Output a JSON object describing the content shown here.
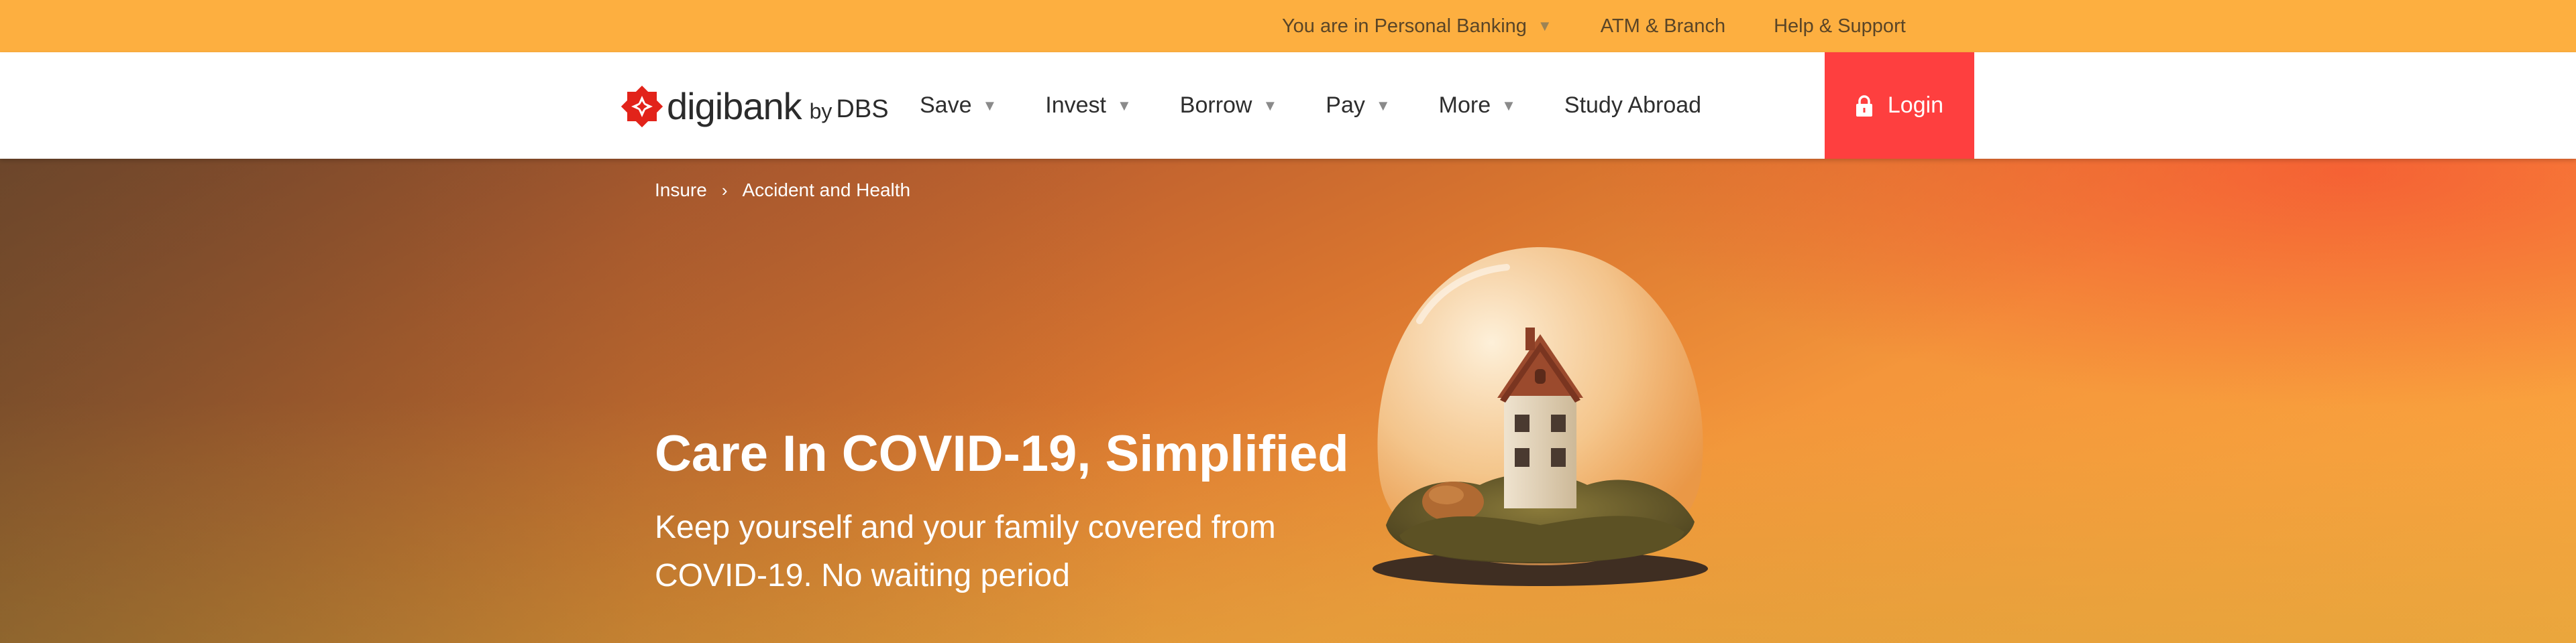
{
  "topbar": {
    "segment_label": "You are in Personal Banking",
    "segment_caret_icon": "caret-down-icon",
    "atm_label": "ATM & Branch",
    "help_label": "Help & Support"
  },
  "brand": {
    "wordmark": "digibank",
    "by": "by",
    "bank": "DBS",
    "colors": {
      "primary_red": "#fe3f3f",
      "topbar_orange": "#fdaf40"
    }
  },
  "nav": {
    "items": [
      {
        "label": "Save",
        "has_dropdown": true
      },
      {
        "label": "Invest",
        "has_dropdown": true
      },
      {
        "label": "Borrow",
        "has_dropdown": true
      },
      {
        "label": "Pay",
        "has_dropdown": true
      },
      {
        "label": "More",
        "has_dropdown": true
      },
      {
        "label": "Study Abroad",
        "has_dropdown": false
      }
    ],
    "caret_icon": "caret-down-icon",
    "login_label": "Login",
    "login_icon": "lock-icon"
  },
  "breadcrumb": {
    "items": [
      "Insure",
      "Accident and Health"
    ],
    "separator_icon": "chevron-right-icon"
  },
  "hero": {
    "title": "Care In COVID-19, Simplified",
    "subtitle": "Keep yourself and your family covered from COVID-19. No waiting period",
    "image": "house-in-glass-dome"
  }
}
